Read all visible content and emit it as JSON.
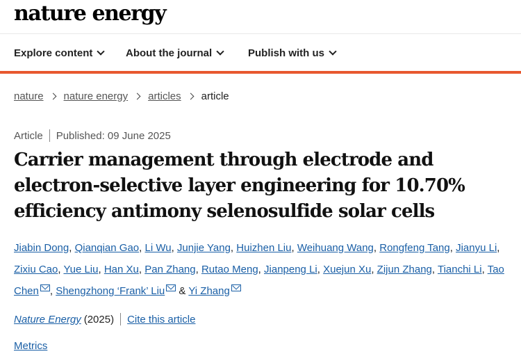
{
  "site": {
    "logo": "nature energy"
  },
  "nav": [
    {
      "label": "Explore content"
    },
    {
      "label": "About the journal"
    },
    {
      "label": "Publish with us"
    }
  ],
  "breadcrumb": [
    "nature",
    "nature energy",
    "articles",
    "article"
  ],
  "article": {
    "type": "Article",
    "published": "Published: 09 June 2025",
    "title": "Carrier management through electrode and electron-selective layer engineering for 10.70% efficiency antimony selenosulfide solar cells",
    "authors": [
      "Jiabin Dong",
      "Qianqian Gao",
      "Li Wu",
      "Junjie Yang",
      "Huizhen Liu",
      "Weihuang Wang",
      "Rongfeng Tang",
      "Jianyu Li",
      "Zixiu Cao",
      "Yue Liu",
      "Han Xu",
      "Pan Zhang",
      "Rutao Meng",
      "Jianpeng Li",
      "Xuejun Xu",
      "Zijun Zhang",
      "Tianchi Li",
      "Tao Chen",
      "Shengzhong ‘Frank’ Liu",
      "Yi Zhang"
    ],
    "author_separator": ", ",
    "author_last_separator": " & ",
    "journal": "Nature Energy",
    "year": "(2025)",
    "cite": "Cite this article",
    "metrics": "Metrics"
  }
}
